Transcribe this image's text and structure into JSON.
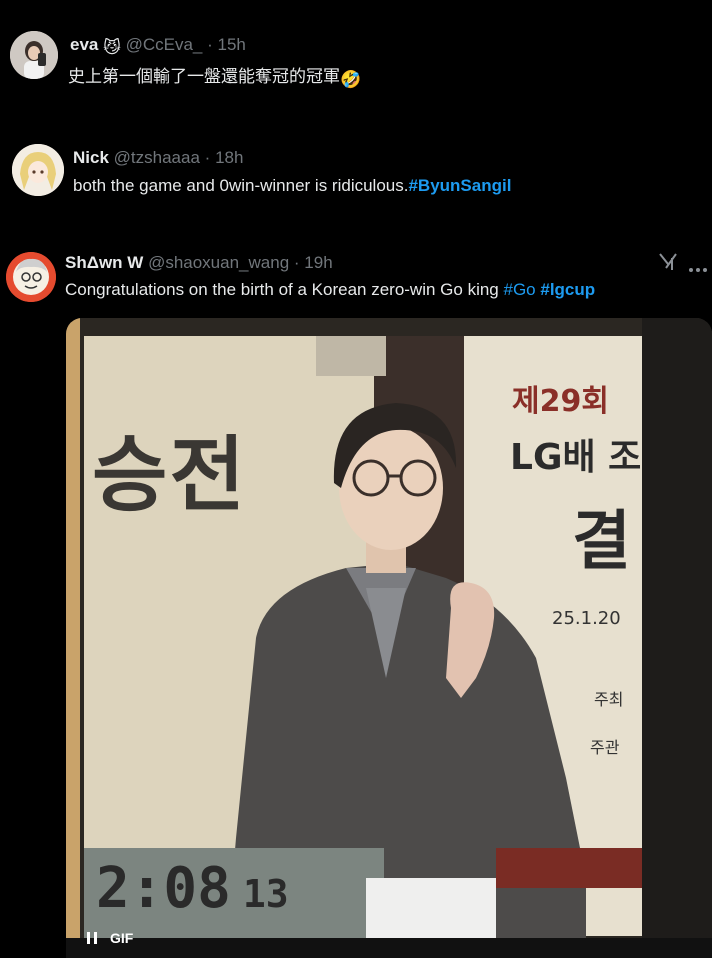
{
  "tweets": [
    {
      "name": "eva",
      "badge_emoji": "😼",
      "handle": "@CcEva_",
      "separator": "·",
      "time": "15h",
      "text": "史上第一個輸了一盤還能奪冠的冠軍",
      "emoji": "🤣"
    },
    {
      "name": "Nick",
      "handle": "@tzshaaaa",
      "separator": "·",
      "time": "18h",
      "text": "both the game and 0win-winner is ridiculous.",
      "hashtag": "#ByunSangil"
    },
    {
      "name": "ShΔwn W",
      "handle": "@shaoxuan_wang",
      "separator": "·",
      "time": "19h",
      "text": "Congratulations on the birth of a Korean zero-win Go king",
      "hashtags": [
        "#Go",
        "#lgcup"
      ],
      "media": {
        "banner_left": "승전",
        "banner_line1": "제29회",
        "banner_line2": "LG배 조",
        "banner_line3": "결",
        "banner_date": "25.1.20",
        "banner_small1": "주최",
        "banner_small2": "주관",
        "clock": "2:08",
        "clock_small": "13",
        "gif_label": "GIF"
      }
    }
  ],
  "colors": {
    "link": "#1d9bf0",
    "muted": "#71767b",
    "text": "#e7e9ea"
  }
}
